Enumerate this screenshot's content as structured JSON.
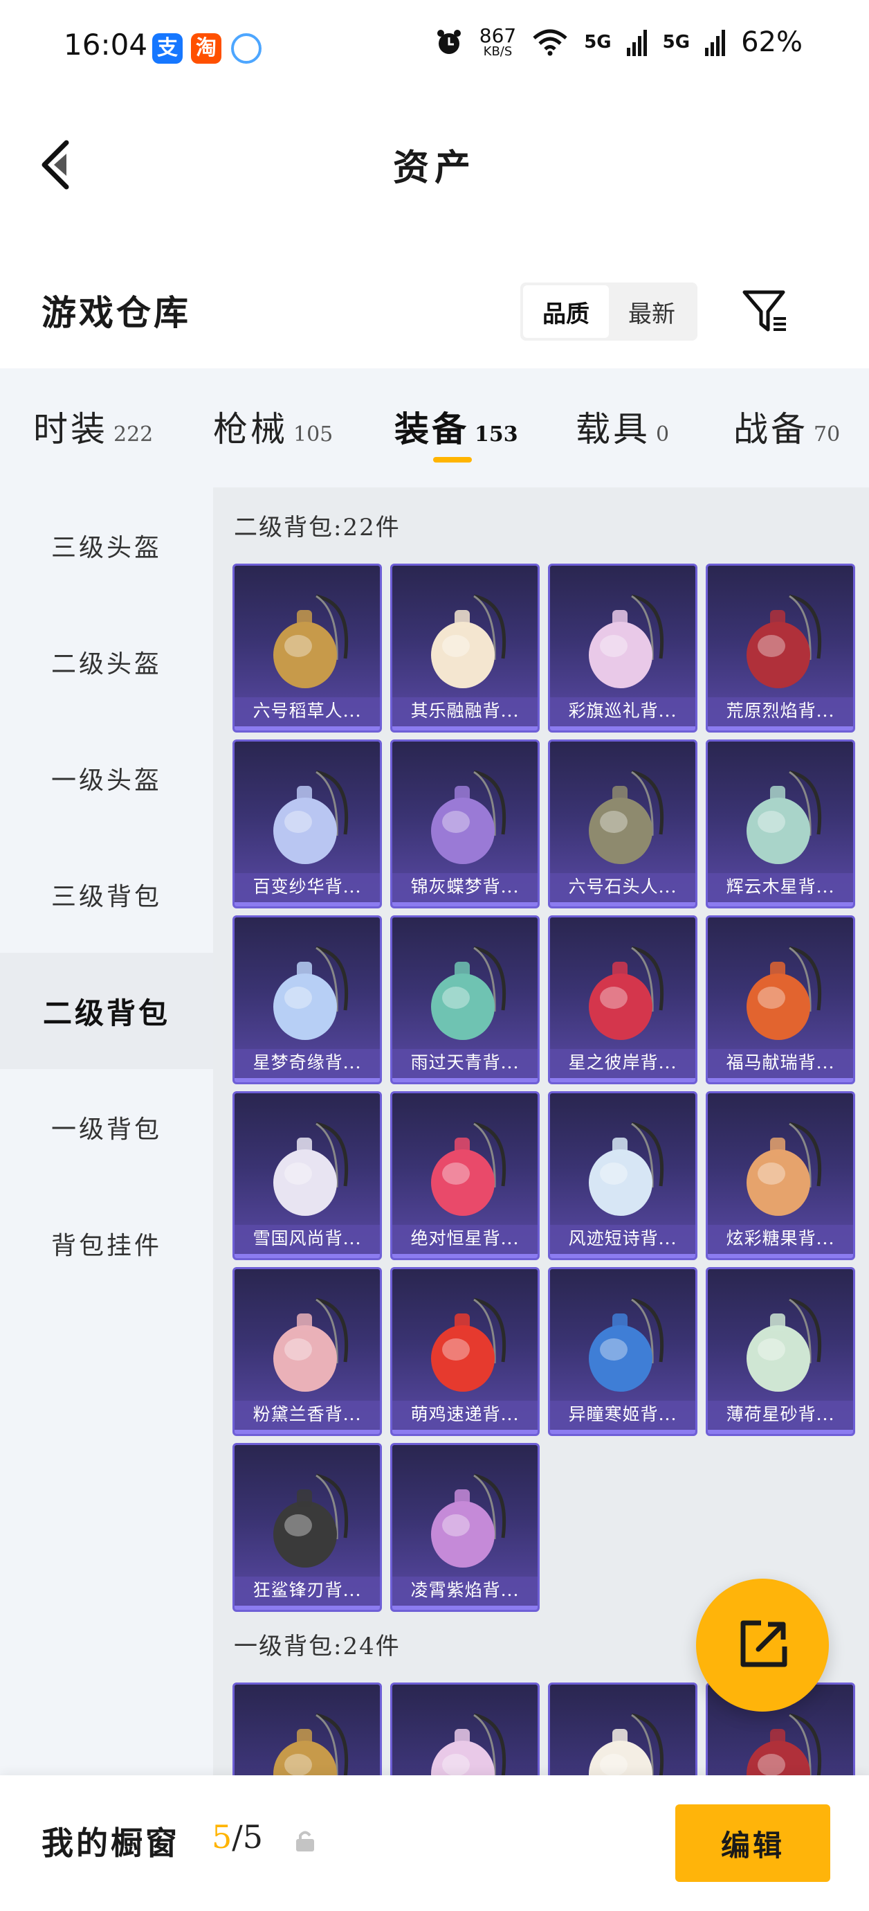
{
  "status_bar": {
    "time": "16:04",
    "net_speed_value": "867",
    "net_speed_unit": "KB/S",
    "signal1": "5G",
    "signal2": "5G",
    "battery": "62%",
    "apps": [
      {
        "name": "alipay-icon",
        "glyph": "支"
      },
      {
        "name": "taobao-icon",
        "glyph": "淘"
      },
      {
        "name": "qq-icon",
        "glyph": ""
      }
    ]
  },
  "header": {
    "title": "资产"
  },
  "warehouse": {
    "title": "游戏仓库",
    "sort_options": [
      "品质",
      "最新"
    ],
    "active_sort": 0
  },
  "category_tabs": [
    {
      "label": "时装",
      "count": "222"
    },
    {
      "label": "枪械",
      "count": "105"
    },
    {
      "label": "装备",
      "count": "153"
    },
    {
      "label": "载具",
      "count": "0"
    },
    {
      "label": "战备",
      "count": "70"
    }
  ],
  "active_category": 2,
  "sidebar": {
    "items": [
      "三级头盔",
      "二级头盔",
      "一级头盔",
      "三级背包",
      "二级背包",
      "一级背包",
      "背包挂件"
    ],
    "active": 4
  },
  "sections": [
    {
      "title": "二级背包:22件",
      "items": [
        {
          "label": "六号稻草人...",
          "color": "#c79a4a"
        },
        {
          "label": "其乐融融背...",
          "color": "#f4e6d0"
        },
        {
          "label": "彩旗巡礼背...",
          "color": "#e9c9e8"
        },
        {
          "label": "荒原烈焰背...",
          "color": "#b0303a"
        },
        {
          "label": "百变纱华背...",
          "color": "#b9c6f2"
        },
        {
          "label": "锦灰蝶梦背...",
          "color": "#9a7ad6"
        },
        {
          "label": "六号石头人...",
          "color": "#8e8a6e"
        },
        {
          "label": "辉云木星背...",
          "color": "#a9d4c9"
        },
        {
          "label": "星梦奇缘背...",
          "color": "#b7cff5"
        },
        {
          "label": "雨过天青背...",
          "color": "#6fc3b2"
        },
        {
          "label": "星之彼岸背...",
          "color": "#d4364c"
        },
        {
          "label": "福马献瑞背...",
          "color": "#e2642f"
        },
        {
          "label": "雪国风尚背...",
          "color": "#e8e4f2"
        },
        {
          "label": "绝对恒星背...",
          "color": "#e94a6a"
        },
        {
          "label": "风迹短诗背...",
          "color": "#d7e6f5"
        },
        {
          "label": "炫彩糖果背...",
          "color": "#e6a36c"
        },
        {
          "label": "粉黛兰香背...",
          "color": "#eab1b8"
        },
        {
          "label": "萌鸡速递背...",
          "color": "#e63a2e"
        },
        {
          "label": "异瞳寒姬背...",
          "color": "#3f7ed6"
        },
        {
          "label": "薄荷星砂背...",
          "color": "#cfe6d3"
        },
        {
          "label": "狂鲨锋刃背...",
          "color": "#3a3a3a"
        },
        {
          "label": "凌霄紫焰背...",
          "color": "#c58ad8"
        }
      ]
    },
    {
      "title": "一级背包:24件",
      "items": [
        {
          "label": "",
          "color": "#c79a4a"
        },
        {
          "label": "",
          "color": "#e9c9e8"
        },
        {
          "label": "",
          "color": "#f4eee4"
        },
        {
          "label": "",
          "color": "#b0303a"
        }
      ]
    }
  ],
  "bottom_bar": {
    "label": "我的橱窗",
    "current": "5",
    "total": "/5",
    "edit_label": "编辑"
  },
  "colors": {
    "accent": "#ffb40a",
    "card_border": "#6e5fd6",
    "panel_bg": "#f2f5f9",
    "content_bg": "#e9ecef"
  }
}
